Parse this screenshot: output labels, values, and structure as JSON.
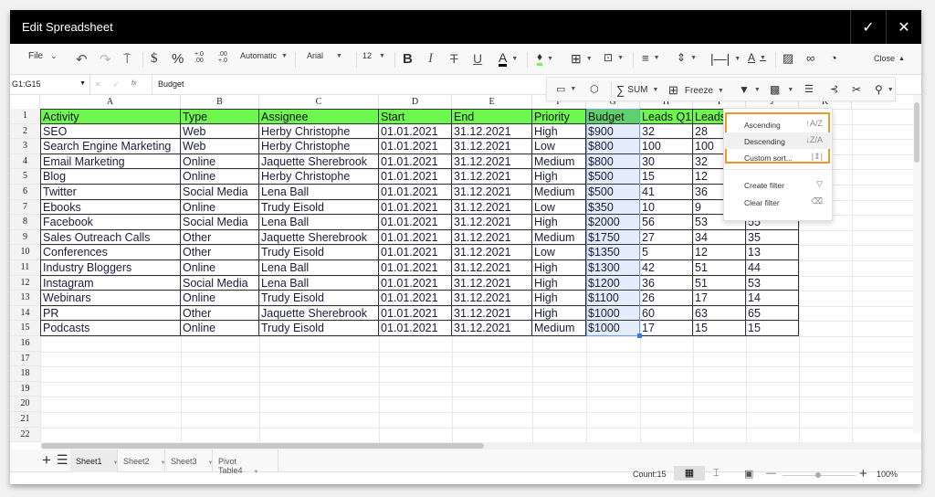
{
  "window": {
    "title": "Edit Spreadsheet",
    "confirm_icon": "✓",
    "close_icon": "✕"
  },
  "toolbar": {
    "file_label": "File",
    "number_format": "Automatic",
    "font_family": "Arial",
    "font_size": "12",
    "close_label": "Close",
    "text_color": "#000000",
    "fill_color": "#6ef74e"
  },
  "toolbar2": {
    "sum_label": "SUM",
    "freeze_label": "Freeze"
  },
  "formula_bar": {
    "cell_ref": "G1:G15",
    "value": "Budget",
    "fx_label": "fx"
  },
  "grid": {
    "columns": [
      "A",
      "B",
      "C",
      "D",
      "E",
      "F",
      "G",
      "H",
      "I",
      "J",
      "K"
    ],
    "row_numbers": [
      "1",
      "2",
      "3",
      "4",
      "5",
      "6",
      "7",
      "8",
      "9",
      "10",
      "11",
      "12",
      "13",
      "14",
      "15",
      "16",
      "17",
      "18",
      "19",
      "20",
      "21",
      "22"
    ],
    "headers": [
      "Activity",
      "Type",
      "Assignee",
      "Start",
      "End",
      "Priority",
      "Budget",
      "Leads Q1",
      "Leads",
      ""
    ],
    "rows": [
      [
        "SEO",
        "Web",
        "Herby Christophe",
        "01.01.2021",
        "31.12.2021",
        "High",
        "$900",
        "32",
        "28",
        ""
      ],
      [
        "Search Engine Marketing",
        "Web",
        "Herby Christophe",
        "01.01.2021",
        "31.12.2021",
        "Low",
        "$800",
        "100",
        "100",
        ""
      ],
      [
        "Email Marketing",
        "Online",
        "Jaquette Sherebrook",
        "01.01.2021",
        "31.12.2021",
        "Medium",
        "$800",
        "30",
        "32",
        ""
      ],
      [
        "Blog",
        "Online",
        "Herby Christophe",
        "01.01.2021",
        "31.12.2021",
        "High",
        "$500",
        "15",
        "12",
        ""
      ],
      [
        "Twitter",
        "Social Media",
        "Lena Ball",
        "01.01.2021",
        "31.12.2021",
        "Medium",
        "$500",
        "41",
        "36",
        ""
      ],
      [
        "Ebooks",
        "Online",
        "Trudy Eisold",
        "01.01.2021",
        "31.12.2021",
        "Low",
        "$350",
        "10",
        "9",
        ""
      ],
      [
        "Facebook",
        "Social Media",
        "Lena Ball",
        "01.01.2021",
        "31.12.2021",
        "High",
        "$2000",
        "56",
        "53",
        "55"
      ],
      [
        "Sales Outreach Calls",
        "Other",
        "Jaquette Sherebrook",
        "01.01.2021",
        "31.12.2021",
        "Medium",
        "$1750",
        "27",
        "34",
        "35"
      ],
      [
        "Conferences",
        "Other",
        "Trudy Eisold",
        "01.01.2021",
        "31.12.2021",
        "Low",
        "$1350",
        "5",
        "12",
        "13"
      ],
      [
        "Industry Bloggers",
        "Online",
        "Lena Ball",
        "01.01.2021",
        "31.12.2021",
        "High",
        "$1300",
        "42",
        "51",
        "44"
      ],
      [
        "Instagram",
        "Social Media",
        "Lena Ball",
        "01.01.2021",
        "31.12.2021",
        "High",
        "$1200",
        "36",
        "51",
        "53"
      ],
      [
        "Webinars",
        "Online",
        "Trudy Eisold",
        "01.01.2021",
        "31.12.2021",
        "High",
        "$1100",
        "26",
        "17",
        "14"
      ],
      [
        "PR",
        "Other",
        "Jaquette Sherebrook",
        "01.01.2021",
        "31.12.2021",
        "High",
        "$1000",
        "60",
        "63",
        "65"
      ],
      [
        "Podcasts",
        "Online",
        "Trudy Eisold",
        "01.01.2021",
        "31.12.2021",
        "Medium",
        "$1000",
        "17",
        "15",
        "15"
      ]
    ],
    "header_color": "#6ef74e",
    "selected_column": "G"
  },
  "filter_menu": {
    "items": [
      {
        "label": "Ascending",
        "icon": "sort-ascending-icon",
        "glyph": "↑A/Z"
      },
      {
        "label": "Descending",
        "icon": "sort-descending-icon",
        "glyph": "↓Z/A"
      },
      {
        "label": "Custom sort...",
        "icon": "custom-sort-icon",
        "glyph": "|⇕|"
      },
      {
        "label": "Create filter",
        "icon": "filter-icon",
        "glyph": "▽"
      },
      {
        "label": "Clear filter",
        "icon": "eraser-icon",
        "glyph": "⌫"
      }
    ],
    "highlight_color": "#f0962e"
  },
  "sheets": {
    "tabs": [
      "Sheet1",
      "Sheet2",
      "Sheet3",
      "Pivot Table4"
    ],
    "active": "Sheet1"
  },
  "status": {
    "count_label": "Count:15",
    "zoom_label": "100%",
    "zoom_value": 100
  }
}
